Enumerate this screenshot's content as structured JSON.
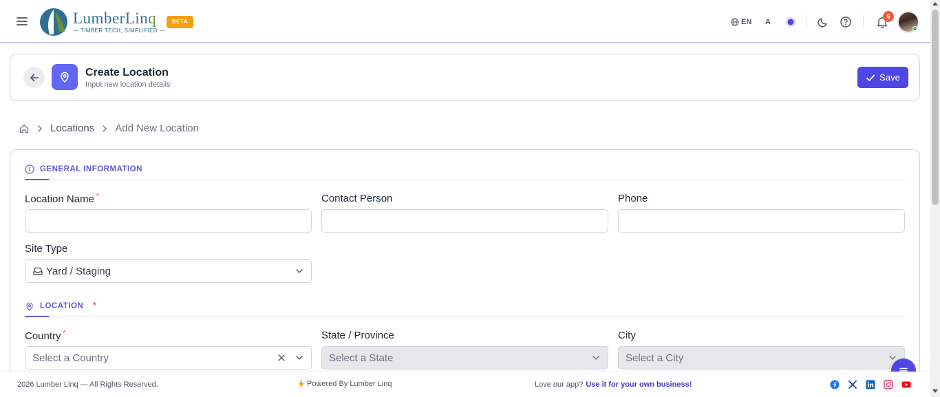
{
  "brand": {
    "logo_word_a": "LumberLin",
    "logo_word_b": "q",
    "tagline": "— TIMBER TECH, SIMPLIFIED —",
    "beta_label": "BETA"
  },
  "topbar": {
    "language": "EN",
    "font_size_label": "A",
    "notification_count": "6"
  },
  "header": {
    "title": "Create Location",
    "subtitle": "Input new location details",
    "save_label": "Save"
  },
  "breadcrumb": {
    "items": [
      "Locations",
      "Add New Location"
    ]
  },
  "sections": {
    "general": "GENERAL INFORMATION",
    "location": "LOCATION",
    "location_required": "*"
  },
  "fields": {
    "location_name": {
      "label": "Location Name",
      "required": "*",
      "value": ""
    },
    "contact_person": {
      "label": "Contact Person",
      "value": ""
    },
    "phone": {
      "label": "Phone",
      "value": ""
    },
    "site_type": {
      "label": "Site Type",
      "value": "Yard / Staging"
    },
    "country": {
      "label": "Country",
      "required": "*",
      "placeholder": "Select a Country"
    },
    "state": {
      "label": "State / Province",
      "placeholder": "Select a State"
    },
    "city": {
      "label": "City",
      "placeholder": "Select a City"
    }
  },
  "footer": {
    "copyright": "2026 Lumber Linq — All Rights Reserved.",
    "powered": "Powered By Lumber Linq",
    "love_text": "Love our app?",
    "love_link": "Use it for your own business!"
  },
  "colors": {
    "primary": "#4f46e5",
    "accent": "#5b5bd6",
    "beta": "#f59e0b",
    "badge": "#f05a3a"
  }
}
